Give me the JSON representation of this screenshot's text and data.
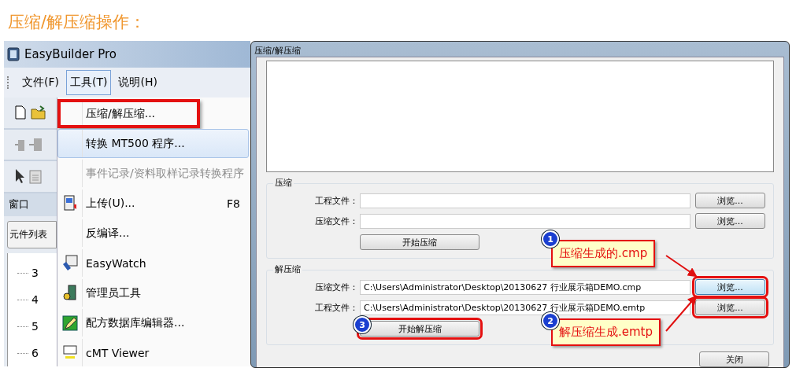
{
  "heading": "压缩/解压缩操作：",
  "app": {
    "title": "EasyBuilder Pro",
    "menus": [
      {
        "label": "文件(F)",
        "selected": false
      },
      {
        "label": "工具(T)",
        "selected": true
      },
      {
        "label": "说明(H)",
        "selected": false
      }
    ],
    "window_label": "窗口",
    "tab": "元件列表",
    "tree": [
      "3",
      "4",
      "5",
      "6"
    ],
    "dropdown": [
      {
        "label": "压缩/解压缩...",
        "selected": false,
        "disabled": false,
        "outlined": true
      },
      {
        "label": "转换 MT500 程序...",
        "selected": true,
        "disabled": false,
        "outlined": false
      },
      {
        "label": "事件记录/资料取样记录转换程序",
        "selected": false,
        "disabled": true,
        "outlined": false
      },
      {
        "label": "上传(U)...",
        "shortcut": "F8",
        "selected": false,
        "disabled": false,
        "outlined": false
      },
      {
        "label": "反编译...",
        "selected": false,
        "disabled": false,
        "outlined": false
      },
      {
        "label": "EasyWatch",
        "selected": false,
        "disabled": false,
        "outlined": false
      },
      {
        "label": "管理员工具",
        "selected": false,
        "disabled": false,
        "outlined": false
      },
      {
        "label": "配方数据库编辑器...",
        "selected": false,
        "disabled": false,
        "outlined": false
      },
      {
        "label": "cMT Viewer",
        "selected": false,
        "disabled": false,
        "outlined": false
      }
    ]
  },
  "dialog": {
    "title": "压缩/解压缩",
    "groups": [
      {
        "title": "压缩",
        "fields": [
          {
            "label": "工程文件：",
            "browse": "浏览...",
            "focused": false,
            "outlined": false
          },
          {
            "label": "压缩文件：",
            "browse": "浏览...",
            "focused": false,
            "outlined": false
          }
        ],
        "start": {
          "label": "开始压缩",
          "outlined": false
        }
      },
      {
        "title": "解压缩",
        "fields": [
          {
            "label": "压缩文件：",
            "value": "C:\\Users\\Administrator\\Desktop\\20130627 行业展示箱DEMO.cmp",
            "browse": "浏览...",
            "focused": true,
            "outlined": true
          },
          {
            "label": "工程文件：",
            "value": "C:\\Users\\Administrator\\Desktop\\20130627 行业展示箱DEMO.emtp",
            "browse": "浏览...",
            "focused": false,
            "outlined": true
          }
        ],
        "start": {
          "label": "开始解压缩",
          "outlined": true,
          "badge": "3"
        }
      }
    ],
    "close": "关闭",
    "callouts": [
      {
        "badge": "1",
        "text": "压缩生成的.cmp"
      },
      {
        "badge": "2",
        "text": "解压缩生成.emtp"
      }
    ]
  }
}
